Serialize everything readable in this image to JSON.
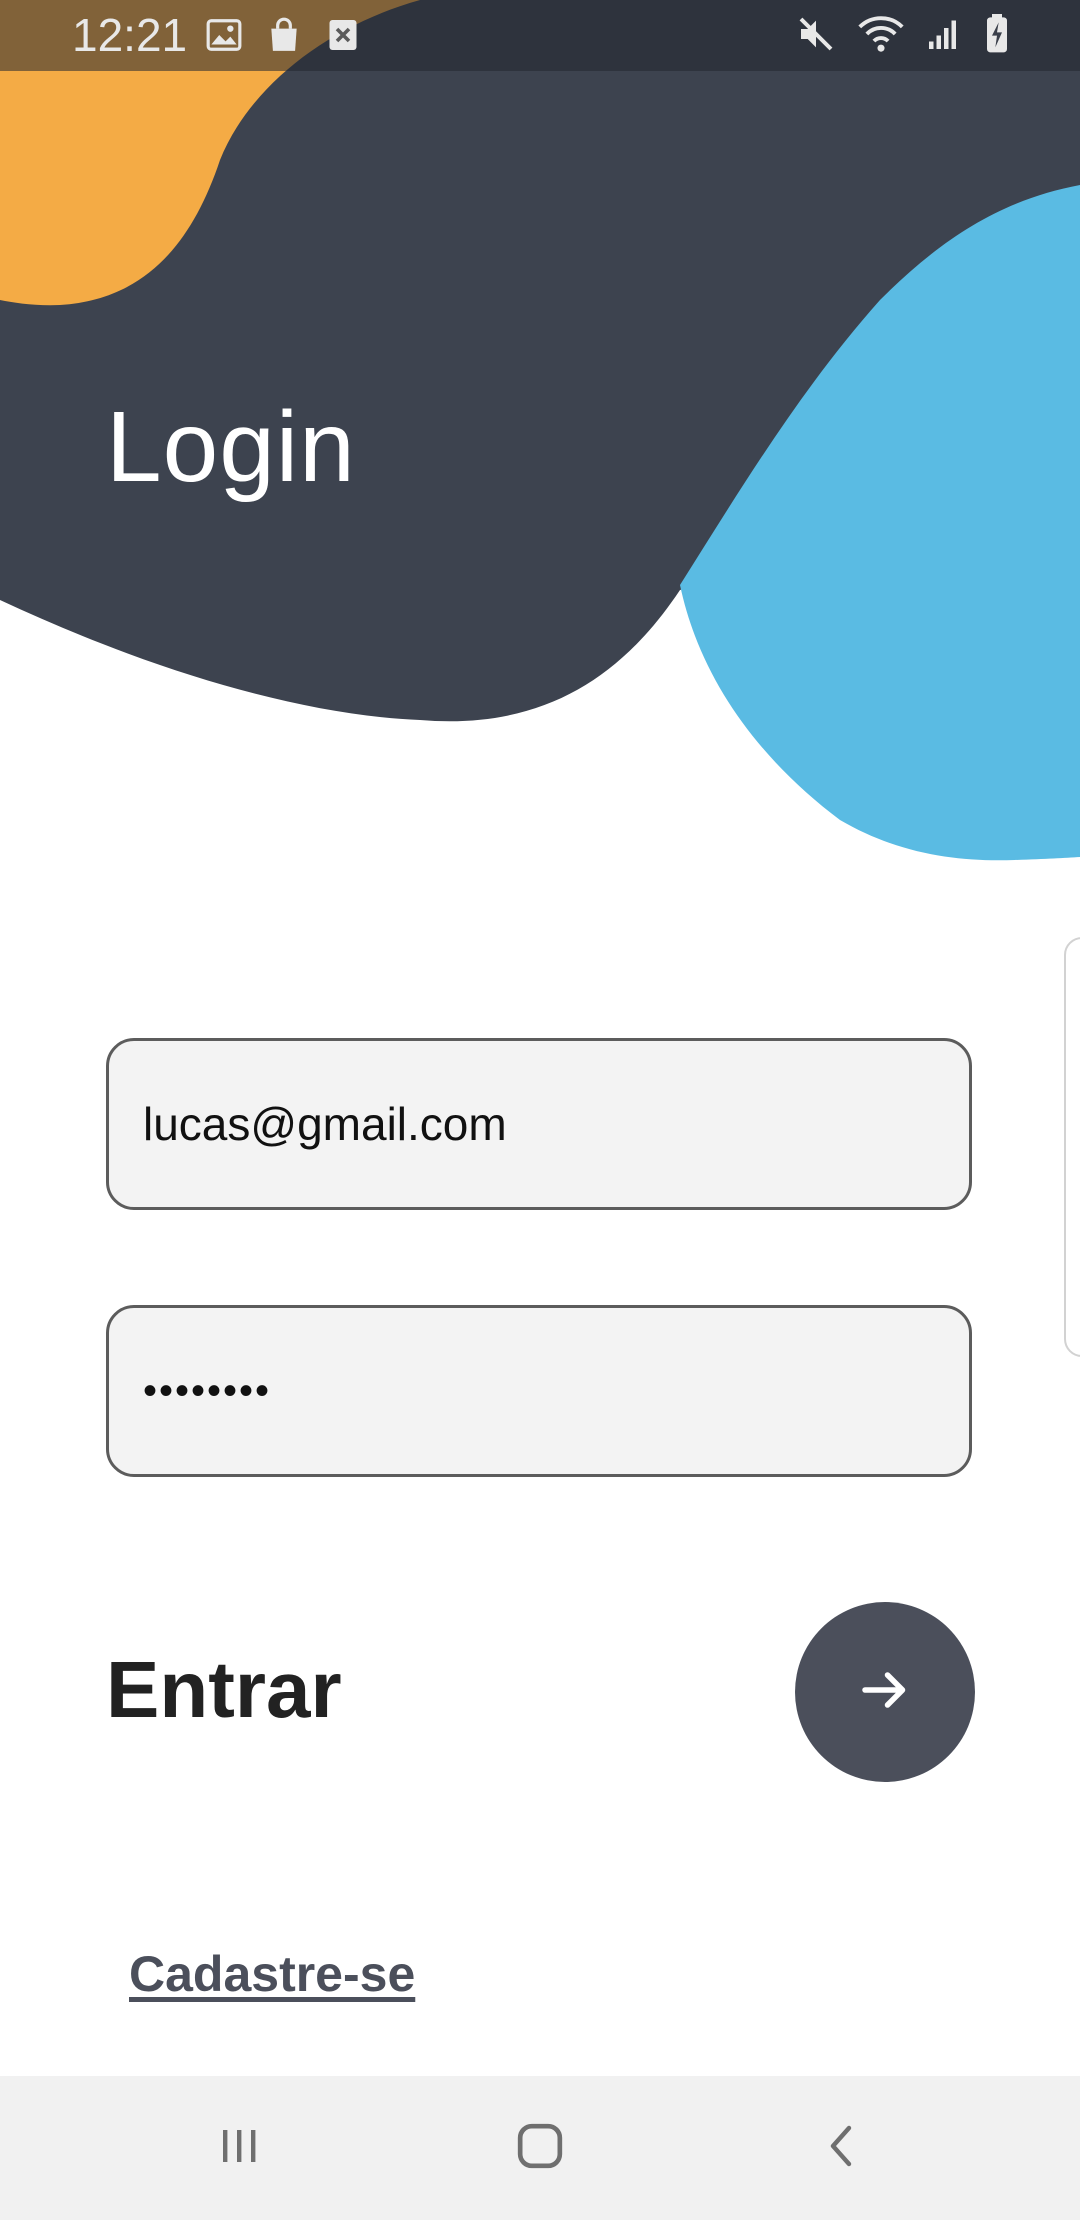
{
  "status_bar": {
    "time": "12:21",
    "left_icons": [
      "image-icon",
      "shopping-bag-icon",
      "close-box-icon"
    ],
    "right_icons": [
      "mute-icon",
      "wifi-icon",
      "signal-icon",
      "battery-charging-icon"
    ]
  },
  "header": {
    "title": "Login"
  },
  "form": {
    "email_value": "lucas@gmail.com",
    "password_value": "••••••••",
    "submit_label": "Entrar",
    "submit_icon": "arrow-right-icon",
    "register_link": "Cadastre-se"
  },
  "nav_bar": {
    "buttons": [
      "recent-apps-icon",
      "home-icon",
      "back-icon"
    ]
  },
  "colors": {
    "dark_shape": "#3d434f",
    "orange_shape": "#f4ab45",
    "blue_shape": "#5abbe3",
    "button": "#4b4f5b",
    "field_bg": "#f3f3f3"
  }
}
